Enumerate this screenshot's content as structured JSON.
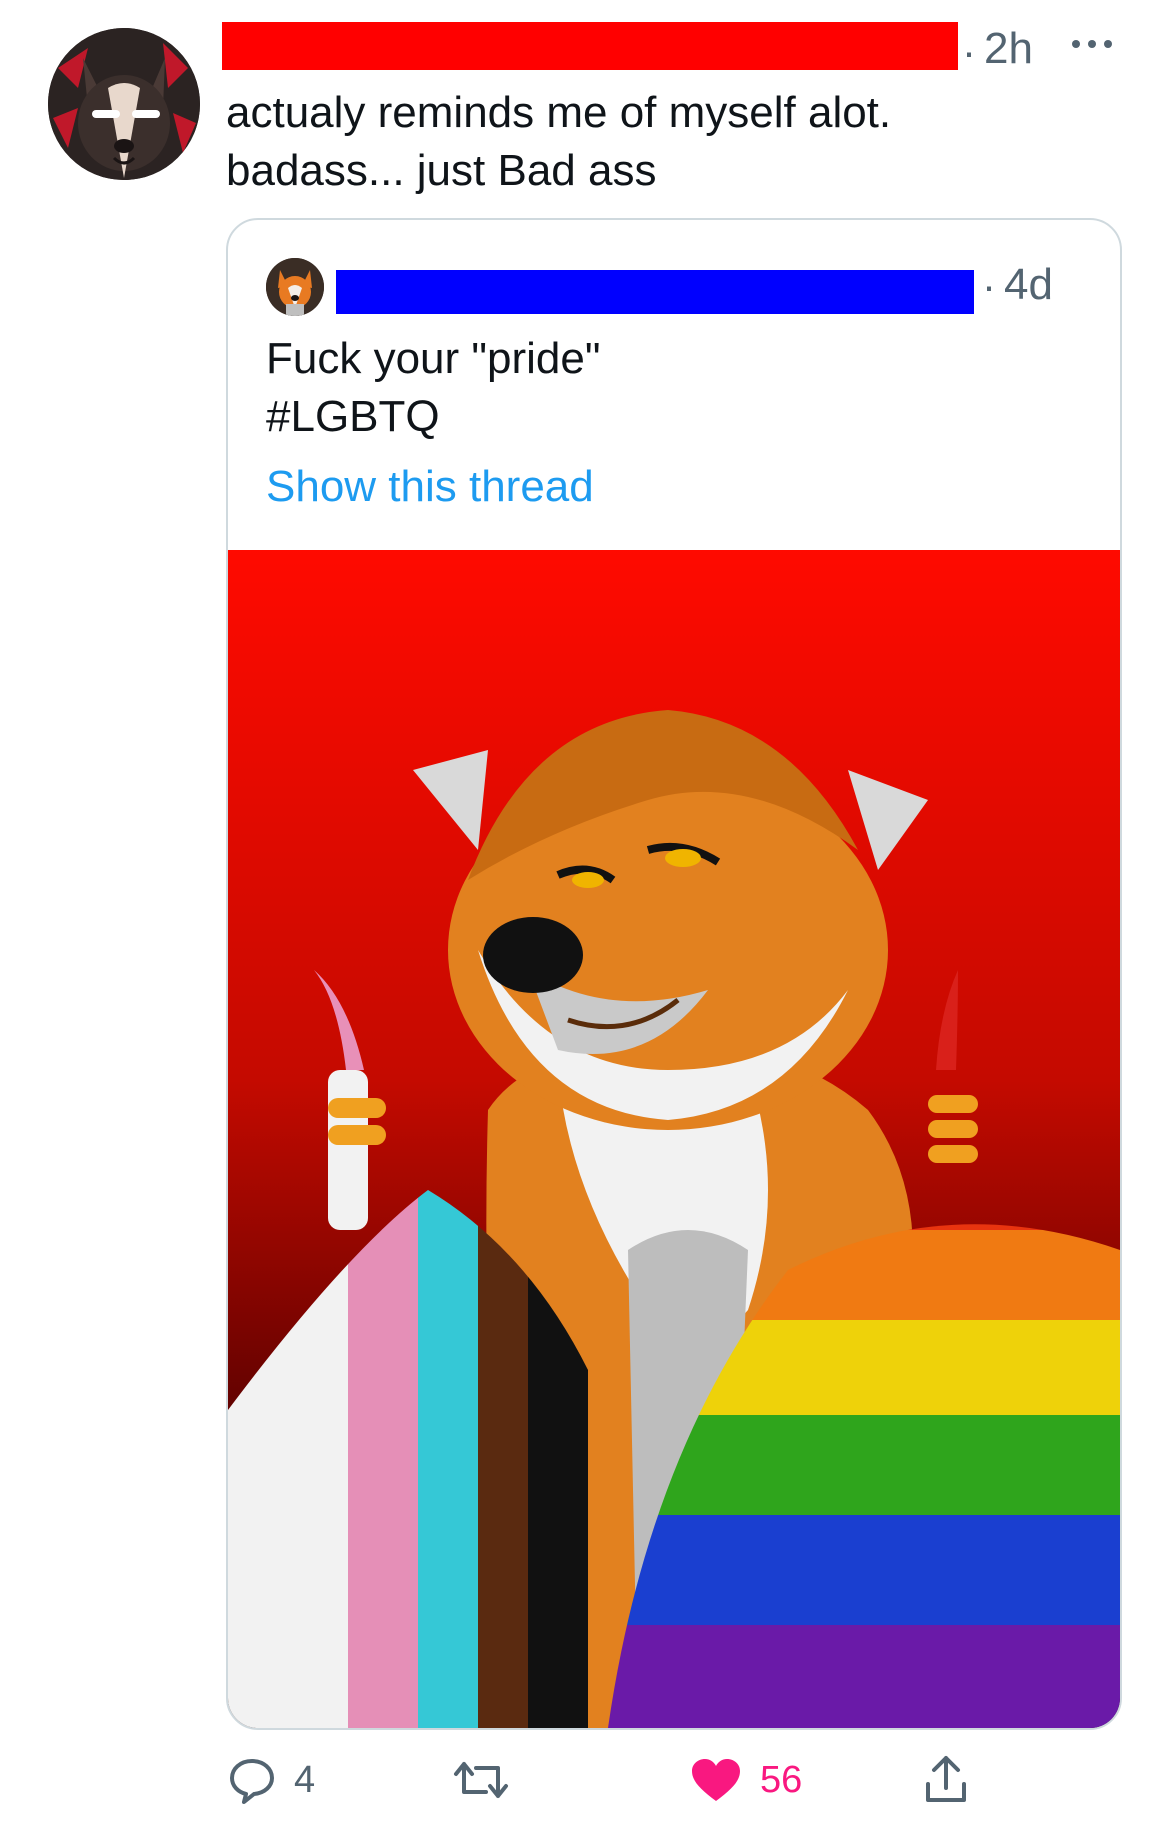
{
  "reply": {
    "time_separator": "·",
    "time": "2h",
    "text_line1": "actualy reminds me of myself alot.",
    "text_line2": "badass... just Bad ass",
    "redaction_color": "#ff0000",
    "avatar_icon": "wolf-avatar-icon"
  },
  "quoted": {
    "time_separator": "·",
    "time": "4d",
    "text_line1": "Fuck your \"pride\"",
    "text_line2": "#LGBTQ",
    "show_thread": "Show this thread",
    "redaction_color": "#0000ff",
    "avatar_icon": "fox-avatar-icon",
    "image_description_icon": "wolf-holding-pride-flags-illustration"
  },
  "actions": {
    "reply_count": "4",
    "retweet_count": "",
    "like_count": "56",
    "reply_icon": "comment-icon",
    "retweet_icon": "retweet-icon",
    "like_icon": "heart-icon",
    "share_icon": "share-icon"
  },
  "colors": {
    "link": "#1d9bf0",
    "like": "#f91880",
    "muted": "#536471"
  }
}
